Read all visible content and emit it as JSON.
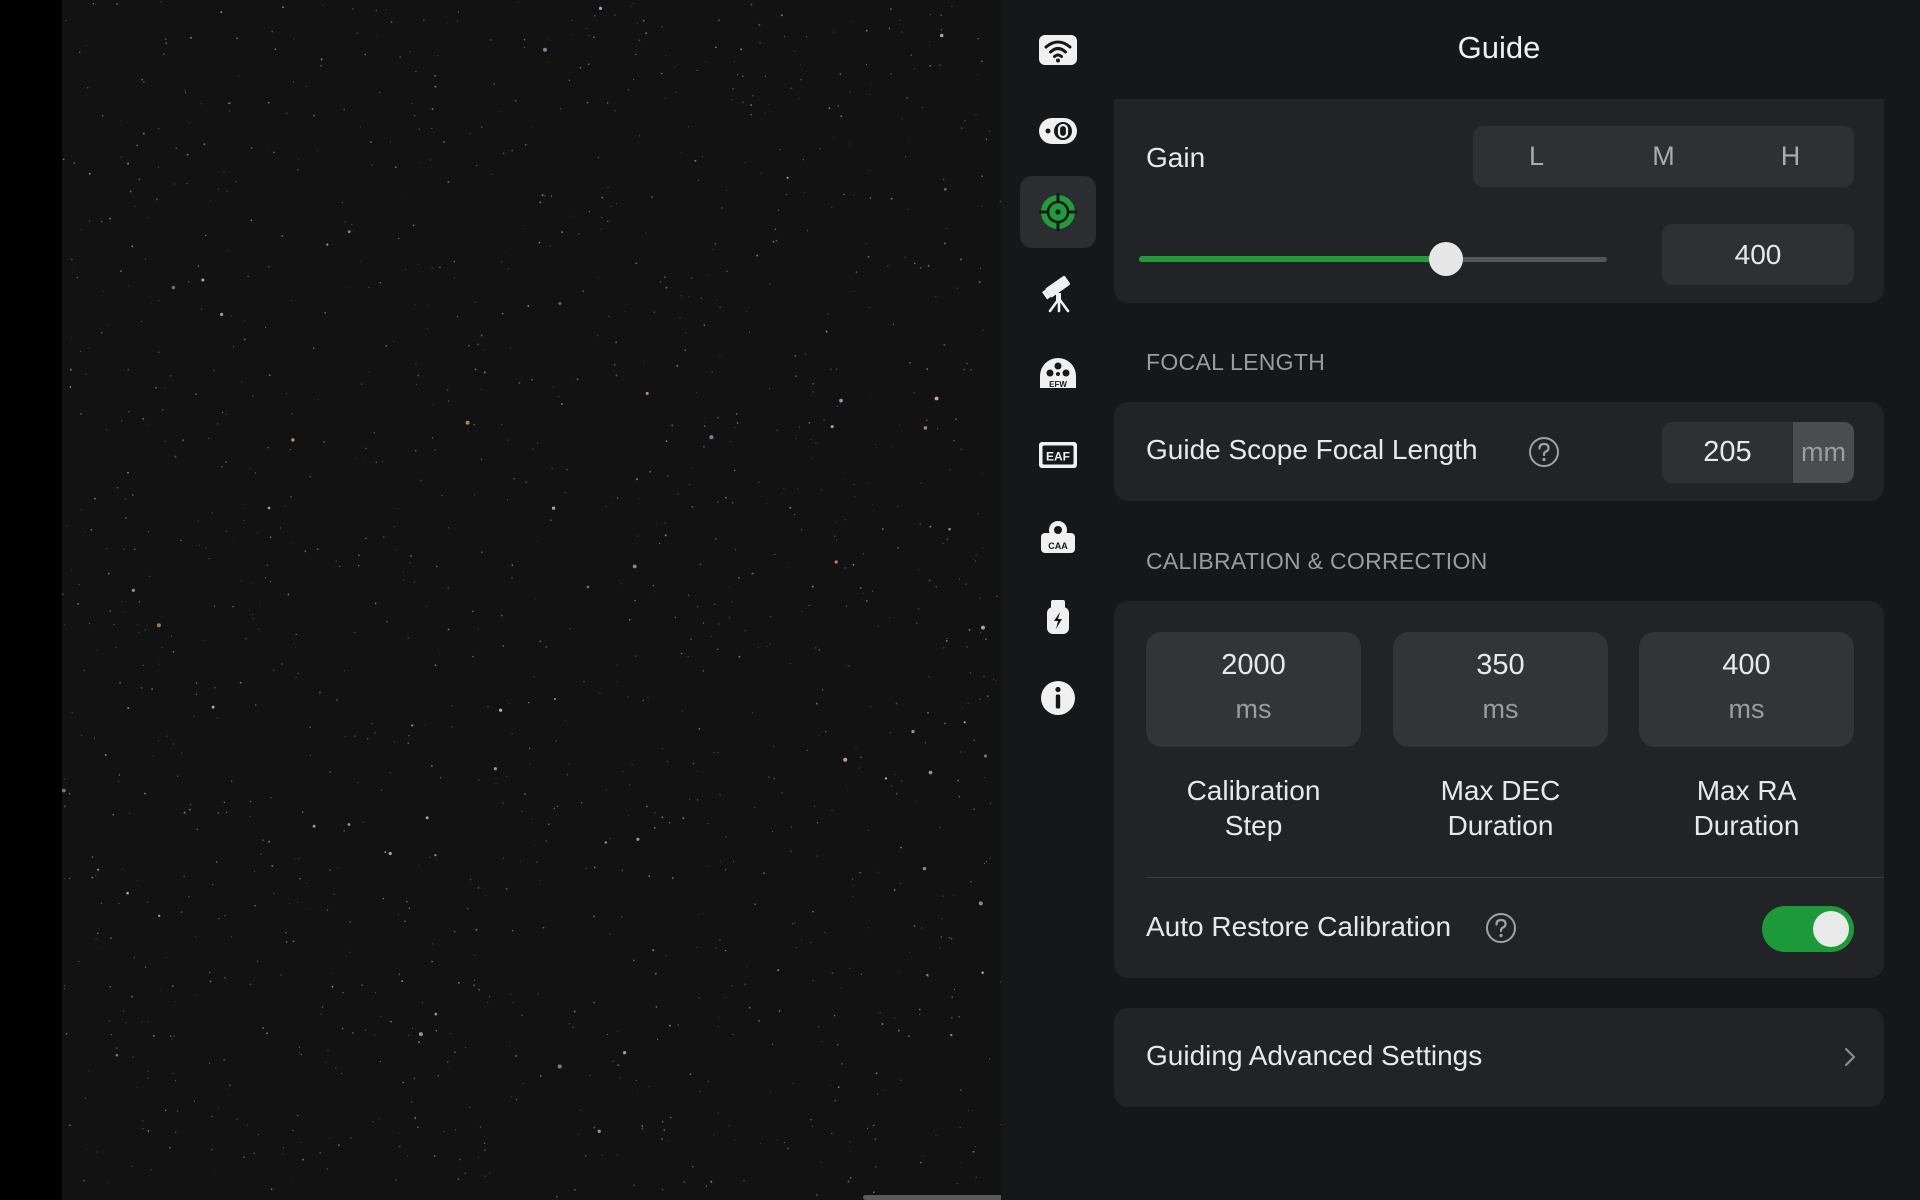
{
  "panel": {
    "title": "Guide"
  },
  "rail": {
    "items": [
      {
        "icon": "wifi-icon",
        "text": "",
        "active": false
      },
      {
        "icon": "camera-icon",
        "text": "",
        "active": false
      },
      {
        "icon": "guide-target-icon",
        "text": "",
        "active": true
      },
      {
        "icon": "telescope-mount-icon",
        "text": "",
        "active": false
      },
      {
        "icon": "filter-wheel-icon",
        "text": "EFW",
        "active": false
      },
      {
        "icon": "focuser-icon",
        "text": "EAF",
        "active": false
      },
      {
        "icon": "rotator-icon",
        "text": "CAA",
        "active": false
      },
      {
        "icon": "usb-power-icon",
        "text": "",
        "active": false
      },
      {
        "icon": "info-icon",
        "text": "",
        "active": false
      }
    ]
  },
  "gain": {
    "label": "Gain",
    "segments": [
      "L",
      "M",
      "H"
    ],
    "value": "400",
    "slider_fraction": 0.655
  },
  "focal_length": {
    "section_title": "FOCAL LENGTH",
    "label": "Guide Scope Focal Length",
    "value": "205",
    "unit": "mm"
  },
  "calibration": {
    "section_title": "CALIBRATION & CORRECTION",
    "params": [
      {
        "value": "2000",
        "unit": "ms",
        "label": "Calibration\nStep"
      },
      {
        "value": "350",
        "unit": "ms",
        "label": "Max DEC\nDuration"
      },
      {
        "value": "400",
        "unit": "ms",
        "label": "Max RA\nDuration"
      }
    ],
    "auto_restore": {
      "label": "Auto Restore Calibration",
      "enabled": true
    }
  },
  "advanced": {
    "label": "Guiding Advanced Settings"
  },
  "colors": {
    "accent": "#1f9d3a",
    "panel_bg": "#161718",
    "card_bg": "#222326"
  }
}
